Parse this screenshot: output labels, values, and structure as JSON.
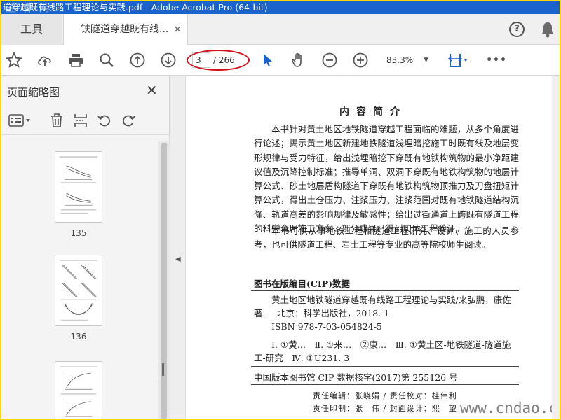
{
  "window": {
    "title": "道穿越既有线路工程理论与实践.pdf - Adobe Acrobat Pro (64-bit)",
    "watermark": "道 林 网"
  },
  "tabs": {
    "tools_label": "工具",
    "doc_label": "铁隧道穿越既有线...",
    "close_label": "×"
  },
  "header": {
    "help_label": "?"
  },
  "toolbar": {
    "page_current": "3",
    "page_total": "/ 266",
    "zoom": "83.3%",
    "more_label": "•••"
  },
  "sidebar": {
    "title": "页面缩略图",
    "close_label": "✕",
    "thumbnails": [
      {
        "page": "135"
      },
      {
        "page": "136"
      }
    ]
  },
  "document": {
    "heading": "内容简介",
    "paragraph1": "本书针对黄土地区地铁隧道穿越工程面临的难题，从多个角度进行论述；揭示黄土地区新建地铁隧道浅埋暗挖施工时既有线及地层变形规律与受力特征，给出浅埋暗挖下穿既有地铁构筑物的最小净距建议值及沉降控制标准；推导单洞、双洞下穿既有地铁构筑物的地层计算公式、砂土地层盾构隧道下穿既有地铁构筑物顶推力及刀盘扭矩计算公式，得出土仓压力、注浆压力、注浆范围对既有地铁隧道结构沉降、轨道高差的影响规律及敏感性；给出过街通道上跨既有隧道工程的科学合理施工方案，部分成果已得到实体工程验证。",
    "paragraph2": "本书可供从事地铁工程和隧道工程研究、设计、施工的人员参考，也可供隧道工程、岩土工程等专业的高等院校师生阅读。",
    "cip_title": "图书在版编目(CIP)数据",
    "cip_line1": "黄土地区地铁隧道穿越既有线路工程理论与实践/来弘鹏，康佐著. —北京：科学出版社，2018. 1",
    "cip_line2": "ISBN 978-7-03-054824-5",
    "cip_line3": "Ⅰ. ①黄…　Ⅱ. ①来…　②康…　Ⅲ. ①黄土区-地铁隧道-隧道施工-研究　Ⅳ. ①U231. 3",
    "cip_number": "中国版本图书馆 CIP 数据核字(2017)第 255126 号",
    "credits1": "责任编辑：张晓娟 / 责任校对：桂伟利",
    "credits2": "责任印制：张　伟 / 封面设计：熙　望",
    "site_watermark": "www.cndao.com"
  }
}
